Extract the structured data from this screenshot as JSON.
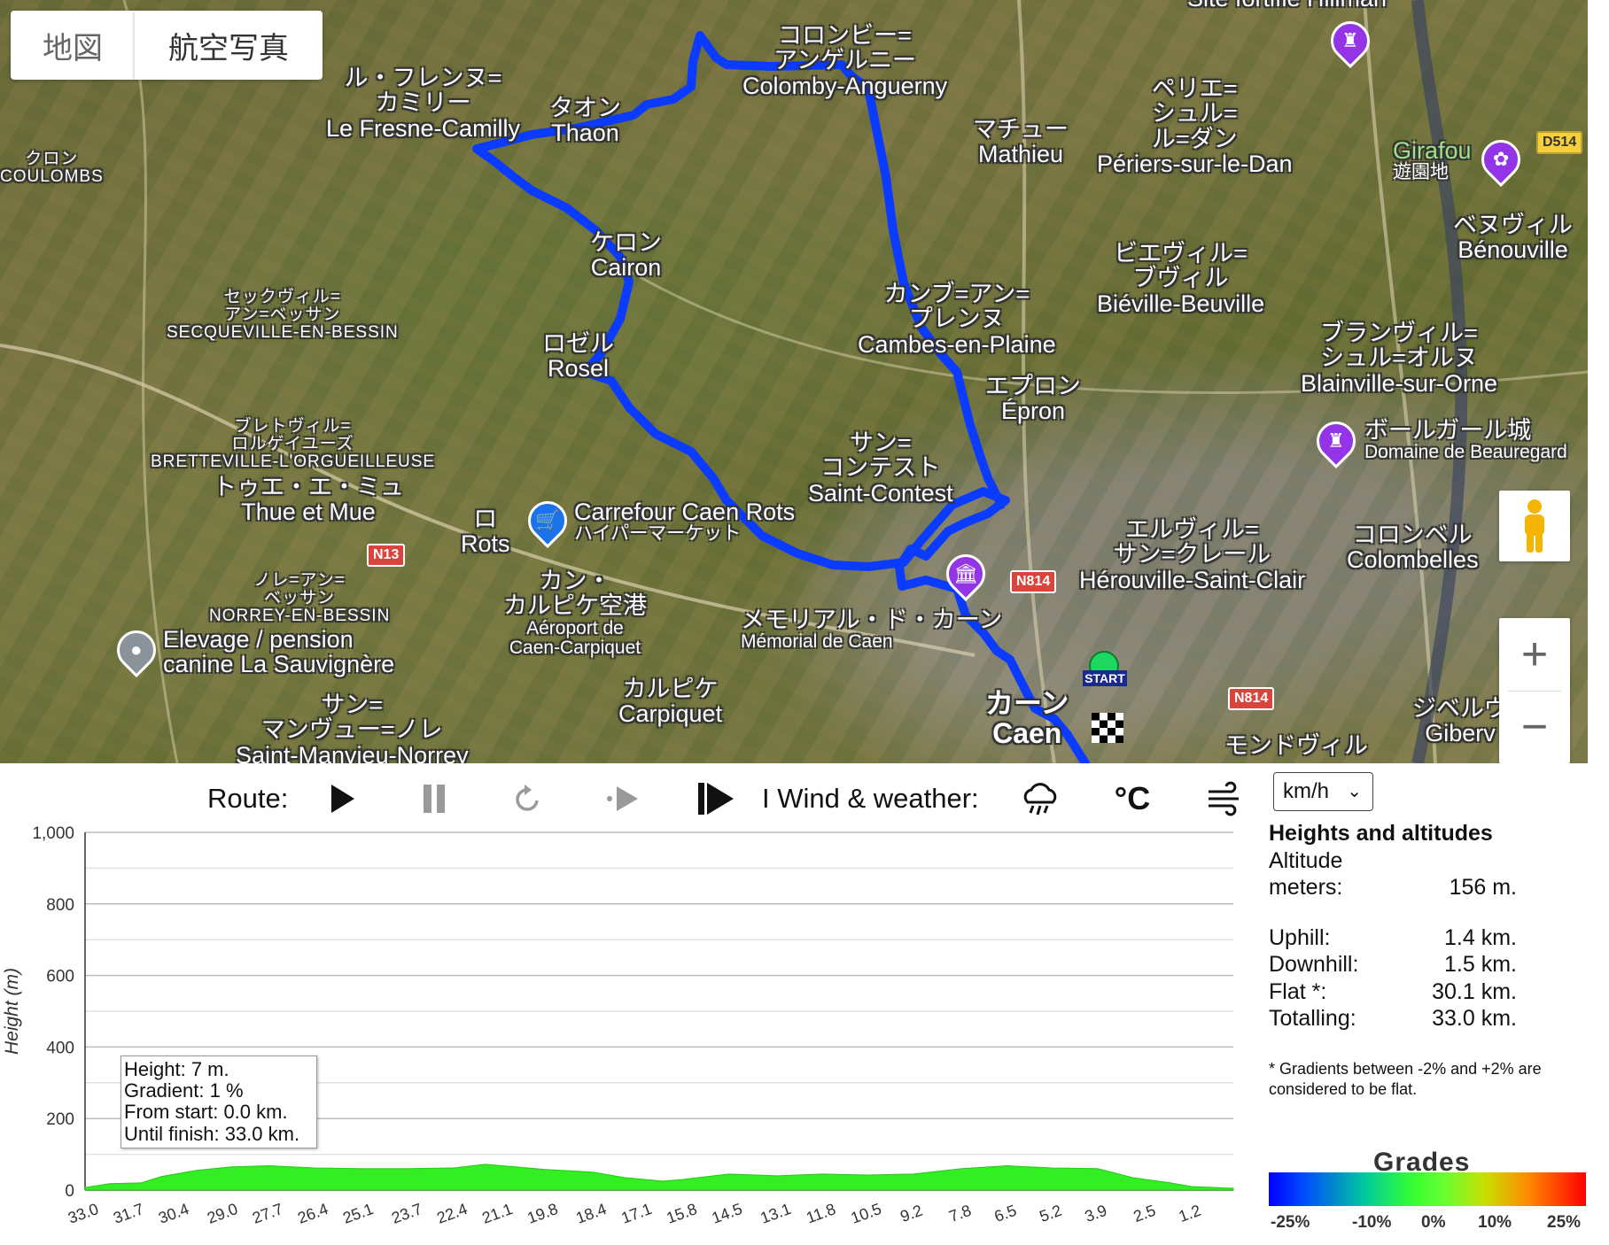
{
  "map": {
    "tabs": [
      {
        "label": "地図"
      },
      {
        "label": "航空写真"
      }
    ],
    "places": [
      {
        "jp": "ル・フレンヌ=\nカミリー",
        "en": "Le Fresne-Camilly"
      },
      {
        "jp": "タオン",
        "en": "Thaon"
      },
      {
        "jp": "コロンビー=\nアンゲルニー",
        "en": "Colomby-Anguerny"
      },
      {
        "jp": "マチュー",
        "en": "Mathieu"
      },
      {
        "jp": "ペリエ=\nシュル=\nル=ダン",
        "en": "Périers-sur-le-Dan"
      },
      {
        "jp": "ベヌヴィル",
        "en": "Bénouville"
      },
      {
        "jp": "ケロン",
        "en": "Cairon"
      },
      {
        "jp": "ビエヴィル=\nブヴィル",
        "en": "Biéville-Beuville"
      },
      {
        "jp": "カンブ=アン=\nプレンヌ",
        "en": "Cambes-en-Plaine"
      },
      {
        "jp": "ブランヴィル=\nシュル=オルヌ",
        "en": "Blainville-sur-Orne"
      },
      {
        "jp": "ロゼル",
        "en": "Rosel"
      },
      {
        "jp": "エプロン",
        "en": "Épron"
      },
      {
        "jp": "サン=\nコンテスト",
        "en": "Saint-Contest"
      },
      {
        "jp": "トゥエ・エ・ミュ",
        "en": "Thue et Mue"
      },
      {
        "jp": "ロ",
        "en": "Rots"
      },
      {
        "jp": "エルヴィル=\nサン=クレール",
        "en": "Hérouville-Saint-Clair"
      },
      {
        "jp": "コロンベル",
        "en": "Colombelles"
      },
      {
        "jp": "カン・\nカルピケ空港",
        "en": "Aéroport de\nCaen-Carpiquet"
      },
      {
        "jp": "カルピケ",
        "en": "Carpiquet"
      },
      {
        "jp": "サン=\nマンヴュー=ノレ",
        "en": "Saint-Manvieu-Norrey"
      },
      {
        "jp": "カーン",
        "en": "Caen"
      },
      {
        "jp": "モンドヴィル",
        "en": ""
      },
      {
        "jp": "ジベルヴ",
        "en": "Giberv"
      }
    ],
    "small_places": [
      {
        "jp": "クロン",
        "en": "COULOMBS"
      },
      {
        "jp": "セックヴィル=\nアン=ベッサン",
        "en": "SECQUEVILLE-EN-BESSIN"
      },
      {
        "jp": "ブレトヴィル=\nロルゲイユーズ",
        "en": "BRETTEVILLE-L'ORGUEILLEUSE"
      },
      {
        "jp": "ノレ=アン=\nベッサン",
        "en": "NORREY-EN-BESSIN"
      }
    ],
    "pois": [
      {
        "name": "Carrefour Caen Rots",
        "sub": "ハイパーマーケット",
        "color": "#1a73e8",
        "icon": "cart-icon"
      },
      {
        "name": "Elevage / pension\ncanine La Sauvignère",
        "sub": "",
        "color": "#8a9399",
        "icon": "pin-icon"
      },
      {
        "name": "ボールガール城",
        "sub": "Domaine de Beauregard",
        "color": "#9334e6",
        "icon": "castle-icon"
      },
      {
        "name": "Girafou",
        "sub": "遊園地",
        "color": "#9334e6",
        "icon": "flower-icon"
      },
      {
        "name": "メモリアル・ド・カーン",
        "sub": "Mémorial de Caen",
        "color": "#9334e6",
        "icon": "museum-icon"
      },
      {
        "name": "Site fortifié Hillman",
        "sub": "",
        "color": "#9334e6",
        "icon": "castle-icon"
      }
    ],
    "roads": [
      "N13",
      "N814",
      "N814",
      "D514"
    ],
    "start_label": "START",
    "route_color": "#0b3bff"
  },
  "toolbar": {
    "route_label": "Route:",
    "wind_label": "I Wind & weather:",
    "unit": "km/h",
    "icons": [
      "play-icon",
      "pause-icon",
      "replay-icon",
      "step-icon",
      "skip-end-icon",
      "rain-icon",
      "celsius-icon",
      "wind-icon"
    ]
  },
  "chart_data": {
    "type": "area",
    "ylabel": "Height (m)",
    "ylim": [
      0,
      1000
    ],
    "yticks": [
      "1,000",
      "800",
      "600",
      "400",
      "200",
      "0"
    ],
    "xticks": [
      "33.0",
      "31.7",
      "30.4",
      "29.0",
      "27.7",
      "26.4",
      "25.1",
      "23.7",
      "22.4",
      "21.1",
      "19.8",
      "18.4",
      "17.1",
      "15.8",
      "14.5",
      "13.1",
      "11.8",
      "10.5",
      "9.2",
      "7.8",
      "6.5",
      "5.2",
      "3.9",
      "2.5",
      "1.2"
    ],
    "x_start": 33.0,
    "x_end": 0.0,
    "profile": [
      [
        33.0,
        7
      ],
      [
        32.3,
        18
      ],
      [
        31.4,
        20
      ],
      [
        30.8,
        38
      ],
      [
        29.8,
        55
      ],
      [
        28.8,
        65
      ],
      [
        27.7,
        68
      ],
      [
        26.4,
        62
      ],
      [
        25.1,
        60
      ],
      [
        23.7,
        60
      ],
      [
        22.4,
        62
      ],
      [
        21.5,
        72
      ],
      [
        21.0,
        68
      ],
      [
        19.8,
        58
      ],
      [
        18.4,
        50
      ],
      [
        17.5,
        35
      ],
      [
        16.4,
        25
      ],
      [
        15.8,
        30
      ],
      [
        14.5,
        45
      ],
      [
        13.1,
        40
      ],
      [
        11.8,
        45
      ],
      [
        10.5,
        42
      ],
      [
        9.2,
        45
      ],
      [
        7.8,
        60
      ],
      [
        6.5,
        68
      ],
      [
        5.2,
        62
      ],
      [
        3.9,
        60
      ],
      [
        2.9,
        35
      ],
      [
        1.8,
        20
      ],
      [
        1.2,
        10
      ],
      [
        0,
        5
      ]
    ],
    "color": "#33ee22",
    "grid": true,
    "tooltip": {
      "height": "Height: 7 m.",
      "gradient": "Gradient: 1 %",
      "from_start": "From start: 0.0 km.",
      "until_finish": "Until finish: 33.0 km."
    }
  },
  "stats": {
    "title": "Heights and altitudes",
    "altitude_label_1": "Altitude",
    "altitude_label_2": "meters:",
    "altitude_value": "156 m.",
    "rows": [
      {
        "label": "Uphill:",
        "value": "1.4 km."
      },
      {
        "label": "Downhill:",
        "value": "1.5 km."
      },
      {
        "label": "Flat *:",
        "value": "30.1 km."
      },
      {
        "label": "Totalling:",
        "value": "33.0 km."
      }
    ],
    "note": "* Gradients between -2% and +2% are considered to be flat."
  },
  "grades": {
    "title": "Grades",
    "ticks": [
      "-25%",
      "-10%",
      "0%",
      "10%",
      "25%"
    ]
  }
}
